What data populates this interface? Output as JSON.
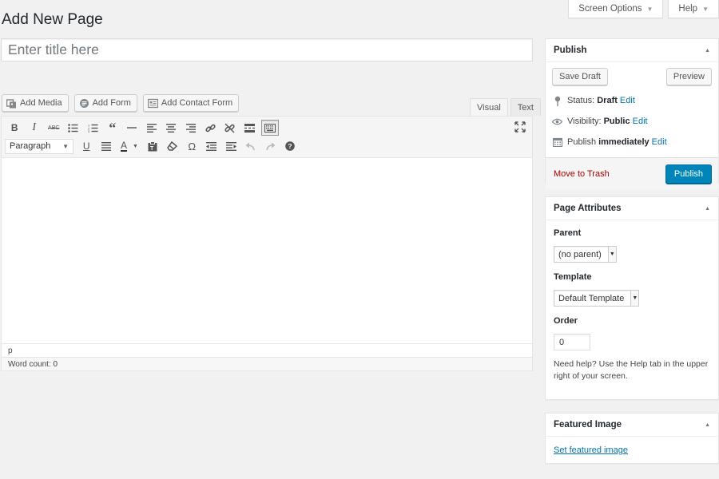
{
  "screen_tabs": {
    "screen_options": "Screen Options",
    "help": "Help"
  },
  "page_title": "Add New Page",
  "title_input": {
    "placeholder": "Enter title here",
    "value": ""
  },
  "media_buttons": {
    "add_media": "Add Media",
    "add_form": "Add Form",
    "add_contact_form": "Add Contact Form"
  },
  "editor_tabs": {
    "visual": "Visual",
    "text": "Text",
    "active": "visual"
  },
  "toolbar": {
    "row1_icons": [
      "bold-icon",
      "italic-icon",
      "strikethrough-icon",
      "bullet-list-icon",
      "numbered-list-icon",
      "blockquote-icon",
      "horizontal-rule-icon",
      "align-left-icon",
      "align-center-icon",
      "align-right-icon",
      "insert-link-icon",
      "remove-link-icon",
      "read-more-icon",
      "toolbar-toggle-icon"
    ],
    "format_select": "Paragraph",
    "row2_icons": [
      "underline-icon",
      "justify-icon",
      "text-color-icon",
      "paste-text-icon",
      "clear-formatting-icon",
      "special-character-icon",
      "outdent-icon",
      "indent-icon",
      "undo-icon",
      "redo-icon",
      "keyboard-shortcuts-icon"
    ]
  },
  "editor": {
    "path": "p",
    "word_count": "Word count: 0"
  },
  "publish_box": {
    "title": "Publish",
    "save_draft": "Save Draft",
    "preview": "Preview",
    "status_label": "Status:",
    "status_value": "Draft",
    "visibility_label": "Visibility:",
    "visibility_value": "Public",
    "publish_label": "Publish",
    "publish_value": "immediately",
    "edit": "Edit",
    "move_to_trash": "Move to Trash",
    "publish_button": "Publish"
  },
  "page_attributes": {
    "title": "Page Attributes",
    "parent_label": "Parent",
    "parent_value": "(no parent)",
    "template_label": "Template",
    "template_value": "Default Template",
    "order_label": "Order",
    "order_value": "0",
    "help_text": "Need help? Use the Help tab in the upper right of your screen."
  },
  "featured_image": {
    "title": "Featured Image",
    "set_link": "Set featured image"
  },
  "colors": {
    "primary": "#0085ba",
    "link": "#0073aa",
    "trash": "#aa0000",
    "background": "#f1f1f1"
  }
}
